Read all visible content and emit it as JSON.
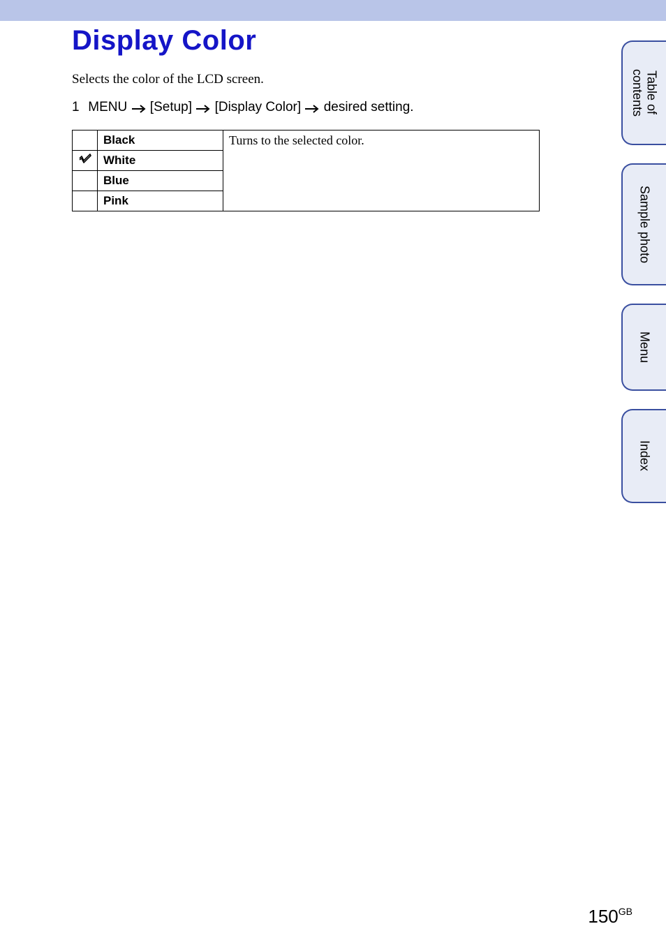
{
  "header": {
    "title": "Display Color",
    "description": "Selects the color of the LCD screen."
  },
  "step": {
    "number": "1",
    "p1": "MENU",
    "p2": "[Setup]",
    "p3": "[Display Color]",
    "p4": "desired setting."
  },
  "table": {
    "explanation": "Turns to the selected color.",
    "options": [
      {
        "checked": false,
        "label": "Black"
      },
      {
        "checked": true,
        "label": "White"
      },
      {
        "checked": false,
        "label": "Blue"
      },
      {
        "checked": false,
        "label": "Pink"
      }
    ]
  },
  "sidenav": {
    "toc_line1": "Table of",
    "toc_line2": "contents",
    "sample": "Sample photo",
    "menu": "Menu",
    "index": "Index"
  },
  "footer": {
    "page": "150",
    "region": "GB"
  }
}
